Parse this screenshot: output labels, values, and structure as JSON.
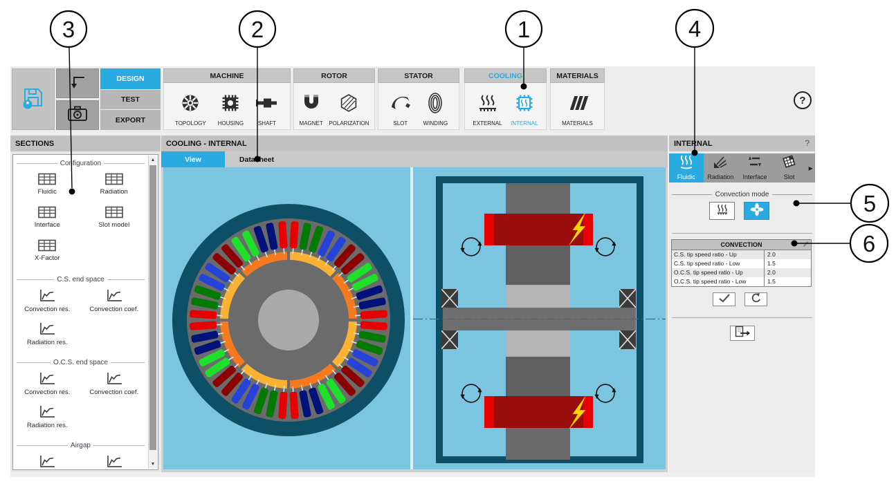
{
  "callouts": [
    {
      "label": "1"
    },
    {
      "label": "2"
    },
    {
      "label": "3"
    },
    {
      "label": "4"
    },
    {
      "label": "5"
    },
    {
      "label": "6"
    }
  ],
  "toolbar": {
    "mode_tabs": [
      {
        "label": "DESIGN",
        "active": true
      },
      {
        "label": "TEST",
        "active": false
      },
      {
        "label": "EXPORT",
        "active": false
      }
    ],
    "groups": [
      {
        "title": "MACHINE",
        "items": [
          {
            "label": "TOPOLOGY"
          },
          {
            "label": "HOUSING"
          },
          {
            "label": "SHAFT"
          }
        ]
      },
      {
        "title": "ROTOR",
        "items": [
          {
            "label": "MAGNET"
          },
          {
            "label": "POLARIZATION"
          }
        ]
      },
      {
        "title": "STATOR",
        "items": [
          {
            "label": "SLOT"
          },
          {
            "label": "WINDING"
          }
        ]
      },
      {
        "title": "COOLING",
        "highlighted": true,
        "items": [
          {
            "label": "EXTERNAL"
          },
          {
            "label": "INTERNAL",
            "active": true
          }
        ]
      },
      {
        "title": "MATERIALS",
        "items": [
          {
            "label": "MATERIALS"
          }
        ]
      }
    ],
    "help_label": "?"
  },
  "sections_panel": {
    "title": "SECTIONS",
    "groups": [
      {
        "title": "Configuration",
        "icon": "table",
        "items": [
          "Fluidic",
          "Radiation",
          "Interface",
          "Slot model",
          "X-Factor"
        ]
      },
      {
        "title": "C.S. end space",
        "icon": "chart",
        "items": [
          "Convection res.",
          "Convection coef.",
          "Radiation res."
        ]
      },
      {
        "title": "O.C.S. end space",
        "icon": "chart",
        "items": [
          "Convection res.",
          "Convection coef.",
          "Radiation res."
        ]
      },
      {
        "title": "Airgap",
        "icon": "chart",
        "items": []
      }
    ]
  },
  "main_panel": {
    "title": "COOLING - INTERNAL",
    "tabs": [
      {
        "label": "View",
        "active": true
      },
      {
        "label": "Datasheet",
        "active": false
      }
    ]
  },
  "right_panel": {
    "title": "INTERNAL",
    "help_label": "?",
    "tabs": [
      {
        "label": "Fluidic",
        "active": true
      },
      {
        "label": "Radiation",
        "active": false
      },
      {
        "label": "Interface",
        "active": false
      },
      {
        "label": "Slot",
        "active": false
      }
    ],
    "convection_mode_title": "Convection mode",
    "table": {
      "title": "CONVECTION",
      "rows": [
        {
          "label": "C.S. tip speed ratio - Up",
          "value": "2.0"
        },
        {
          "label": "C.S. tip speed ratio - Low",
          "value": "1.5"
        },
        {
          "label": "O.C.S. tip speed ratio - Up",
          "value": "2.0"
        },
        {
          "label": "O.C.S. tip speed ratio - Low",
          "value": "1.5"
        }
      ]
    }
  },
  "colors": {
    "accent": "#29abe2",
    "canvas_blue": "#7cc5e0",
    "housing_teal": "#0e4f68"
  },
  "radial_view": {
    "slot_count": 48,
    "start_angle": -93.75,
    "slot_pattern": [
      "#e60000",
      "#e60000",
      "#007a00",
      "#007a00",
      "#2543d8",
      "#2543d8",
      "#8b0000",
      "#8b0000",
      "#1ee02a",
      "#1ee02a",
      "#00127a",
      "#00127a"
    ],
    "tick_color": "#cfeaf4",
    "magnet_segments": 8,
    "magnet_colors": [
      "#f9b233",
      "#f4791f"
    ]
  }
}
